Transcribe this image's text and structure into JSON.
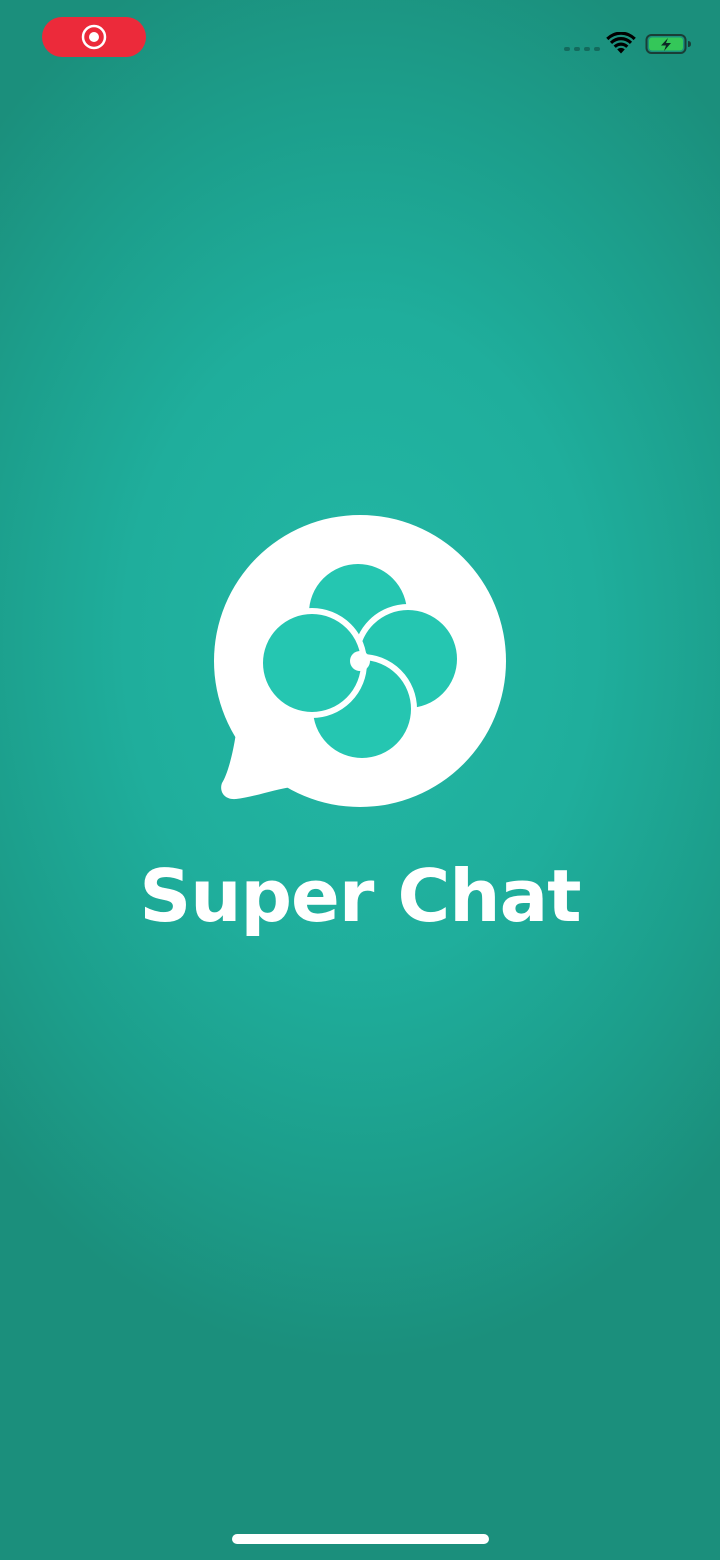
{
  "app": {
    "name": "Super Chat"
  },
  "status_bar": {
    "recording_indicator_icon": "screen-record-icon",
    "wifi_icon": "wifi-icon",
    "battery_icon": "battery-charging-icon",
    "recording_color": "#ec2a3a",
    "battery_color": "#34c759"
  },
  "theme": {
    "background": "#1fae9c",
    "logo_fill": "#ffffff",
    "logo_accent": "#25c6b1"
  }
}
